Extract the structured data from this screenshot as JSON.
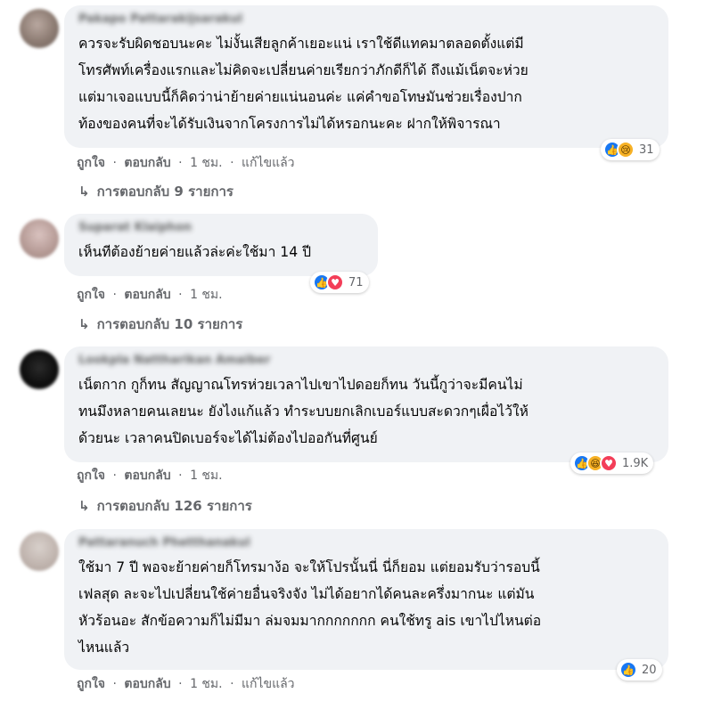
{
  "comments": [
    {
      "author": "Pakapo Pattarakijsarakul",
      "text": "ควรจะรับผิดชอบนะคะ ไม่งั้นเสียลูกค้าเยอะแน่ เราใช้ดีแทคมาตลอดตั้งแต่มี\nโทรศัพท์เครื่องแรกและไม่คิดจะเปลี่ยนค่ายเรียกว่าภักดีก็ได้ ถึงแม้เน็ตจะห่วย\nแต่มาเจอแบบนี้ก็คิดว่าน่าย้ายค่ายแน่นอนค่ะ แค่คำขอโทษมันช่วยเรื่องปาก\nท้องของคนที่จะได้รับเงินจากโครงการไม่ได้หรอกนะคะ ฝากให้พิจารณา",
      "reaction_icons": [
        "like",
        "sad"
      ],
      "reaction_count": "31",
      "like": "ถูกใจ",
      "reply": "ตอบกลับ",
      "time": "1 ชม.",
      "edited": "แก้ไขแล้ว",
      "replies": "การตอบกลับ 9 รายการ"
    },
    {
      "author": "Suparat Klaiphon",
      "text": "เห็นทีต้องย้ายค่ายแล้วล่ะค่ะใช้มา 14 ปี",
      "reaction_icons": [
        "like",
        "love"
      ],
      "reaction_count": "71",
      "like": "ถูกใจ",
      "reply": "ตอบกลับ",
      "time": "1 ชม.",
      "replies": "การตอบกลับ 10 รายการ"
    },
    {
      "author": "Lookpla Nattharikan Amaiber",
      "text": "เน็ตกาก กูก็ทน สัญญาณโทรห่วยเวลาไปเขาไปดอยก็ทน วันนี้กูว่าจะมีคนไม่\nทนมึงหลายคนเลยนะ ยังไงแก้แล้ว ทำระบบยกเลิกเบอร์แบบสะดวกๆเผื่อไว้ให้\nด้วยนะ เวลาคนปิดเบอร์จะได้ไม่ต้องไปออกันที่ศูนย์",
      "reaction_icons": [
        "like",
        "haha",
        "love"
      ],
      "reaction_count": "1.9K",
      "like": "ถูกใจ",
      "reply": "ตอบกลับ",
      "time": "1 ชม.",
      "replies": "การตอบกลับ 126 รายการ"
    },
    {
      "author": "Pattaranuch Phetthanakul",
      "text": "ใช้มา 7 ปี พอจะย้ายค่ายก็โทรมาง้อ จะให้โปรนั้นนี่ นี่ก็ยอม แต่ยอมรับว่ารอบนี้\nเฟลสุด ละจะไปเปลี่ยนใช้ค่ายอื่นจริงจัง ไม่ได้อยากได้คนละครึ่งมากนะ แต่มัน\nหัวร้อนอะ สักข้อความก็ไม่มีมา ล่มจมมากกกกกกก คนใช้ทรู ais เขาไปไหนต่อ\nไหนแล้ว",
      "reaction_icons": [
        "like"
      ],
      "reaction_count": "20",
      "like": "ถูกใจ",
      "reply": "ตอบกลับ",
      "time": "1 ชม.",
      "edited": "แก้ไขแล้ว"
    }
  ],
  "icons": {
    "like": "👍",
    "sad": "😢",
    "love": "♥",
    "haha": "😆",
    "reply_arrow": "↳"
  },
  "separator": "·"
}
